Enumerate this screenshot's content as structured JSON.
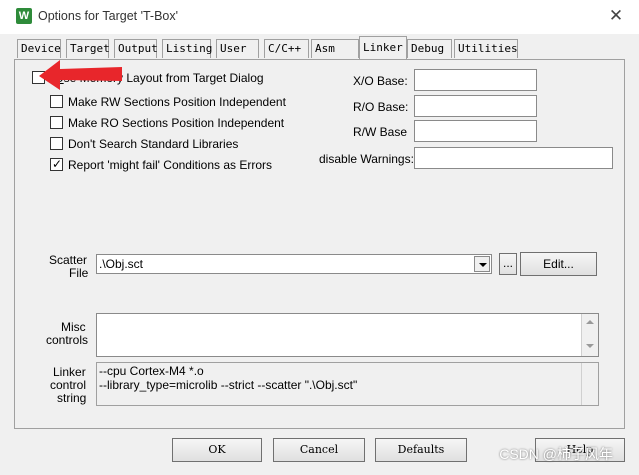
{
  "window": {
    "title": "Options for Target 'T-Box'",
    "icon_letter": "W",
    "close_glyph": "✕"
  },
  "tabs": [
    {
      "label": "Device"
    },
    {
      "label": "Target"
    },
    {
      "label": "Output"
    },
    {
      "label": "Listing"
    },
    {
      "label": "User"
    },
    {
      "label": "C/C++"
    },
    {
      "label": "Asm"
    },
    {
      "label": "Linker",
      "active": true
    },
    {
      "label": "Debug"
    },
    {
      "label": "Utilities"
    }
  ],
  "linker": {
    "options": [
      {
        "label_u": "U",
        "label": "se Memory Layout from Target Dialog",
        "checked": false
      },
      {
        "label": "Make RW Sections Position Independent",
        "checked": false
      },
      {
        "label": "Make RO Sections Position Independent",
        "checked": false
      },
      {
        "label": "Don't Search Standard Libraries",
        "checked": false
      },
      {
        "label": "Report 'might fail' Conditions as Errors",
        "checked": true
      }
    ],
    "bases": [
      {
        "label": "X/O Base:",
        "value": ""
      },
      {
        "label": "R/O Base:",
        "value": ""
      },
      {
        "label": "R/W Base",
        "value": ""
      },
      {
        "label": "disable Warnings:",
        "value": ""
      }
    ],
    "scatter": {
      "label_line1": "Scatter",
      "label_line2": "File",
      "value": ".\\Obj.sct",
      "browse_label": "...",
      "edit_label": "Edit..."
    },
    "misc": {
      "label_line1": "Misc",
      "label_line2": "controls",
      "value": ""
    },
    "control_string": {
      "label_line1": "Linker",
      "label_line2": "control",
      "label_line3": "string",
      "line1": "--cpu Cortex-M4 *.o",
      "line2": "--library_type=microlib --strict --scatter \".\\Obj.sct\""
    }
  },
  "buttons": {
    "ok": "OK",
    "cancel": "Cancel",
    "defaults": "Defaults",
    "help": "Help"
  },
  "annotation": {
    "color": "#e8262b"
  },
  "watermark": "CSDN @柿子风年"
}
